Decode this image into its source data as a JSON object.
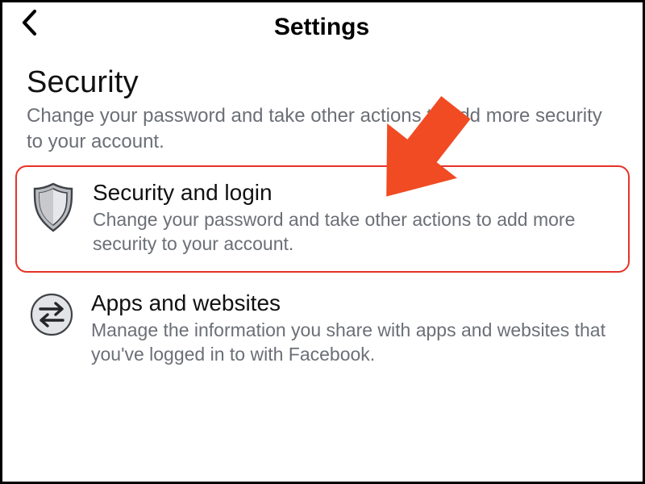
{
  "header": {
    "title": "Settings"
  },
  "section": {
    "heading": "Security",
    "description": "Change your password and take other actions to add more security to your account."
  },
  "items": [
    {
      "title": "Security and login",
      "description": "Change your password and take other actions to add more security to your account."
    },
    {
      "title": "Apps and websites",
      "description": "Manage the information you share with apps and websites that you've logged in to with Facebook."
    }
  ],
  "annotation": {
    "arrow_color": "#f04b23",
    "highlight_color": "#e63228"
  }
}
